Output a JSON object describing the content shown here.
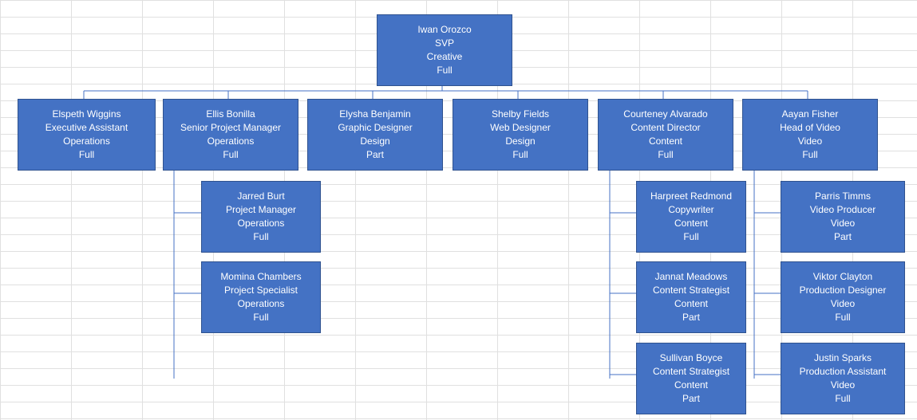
{
  "nodes": {
    "root": {
      "name": "Iwan Orozco",
      "title": "SVP",
      "dept": "Creative",
      "status": "Full"
    },
    "l1_0": {
      "name": "Elspeth Wiggins",
      "title": "Executive Assistant",
      "dept": "Operations",
      "status": "Full"
    },
    "l1_1": {
      "name": "Ellis Bonilla",
      "title": "Senior Project Manager",
      "dept": "Operations",
      "status": "Full"
    },
    "l1_2": {
      "name": "Elysha Benjamin",
      "title": "Graphic Designer",
      "dept": "Design",
      "status": "Part"
    },
    "l1_3": {
      "name": "Shelby Fields",
      "title": "Web Designer",
      "dept": "Design",
      "status": "Full"
    },
    "l1_4": {
      "name": "Courteney Alvarado",
      "title": "Content Director",
      "dept": "Content",
      "status": "Full"
    },
    "l1_5": {
      "name": "Aayan Fisher",
      "title": "Head of Video",
      "dept": "Video",
      "status": "Full"
    },
    "c1_0": {
      "name": "Jarred Burt",
      "title": "Project Manager",
      "dept": "Operations",
      "status": "Full"
    },
    "c1_1": {
      "name": "Momina Chambers",
      "title": "Project Specialist",
      "dept": "Operations",
      "status": "Full"
    },
    "c4_0": {
      "name": "Harpreet Redmond",
      "title": "Copywriter",
      "dept": "Content",
      "status": "Full"
    },
    "c4_1": {
      "name": "Jannat Meadows",
      "title": "Content Strategist",
      "dept": "Content",
      "status": "Part"
    },
    "c4_2": {
      "name": "Sullivan Boyce",
      "title": "Content Strategist",
      "dept": "Content",
      "status": "Part"
    },
    "c5_0": {
      "name": "Parris Timms",
      "title": "Video Producer",
      "dept": "Video",
      "status": "Part"
    },
    "c5_1": {
      "name": "Viktor Clayton",
      "title": "Production Designer",
      "dept": "Video",
      "status": "Full"
    },
    "c5_2": {
      "name": "Justin Sparks",
      "title": "Production Assistant",
      "dept": "Video",
      "status": "Full"
    }
  },
  "colors": {
    "node": "#4472C4",
    "connector": "#4472C4"
  }
}
